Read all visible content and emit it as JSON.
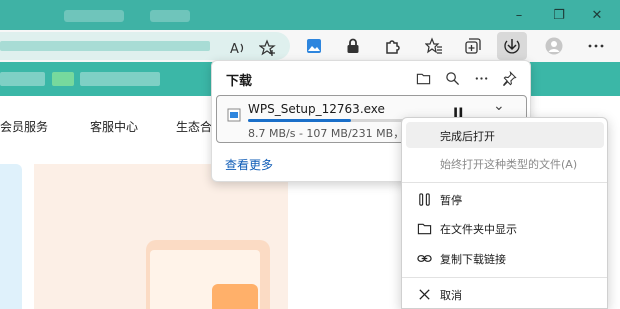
{
  "window": {
    "minimize_icon": "minimize-icon",
    "maximize_icon": "restore-icon",
    "close_icon": "close-icon"
  },
  "toolbar": {
    "read_aloud_icon": "read-aloud-icon",
    "favorite_add_icon": "star-add-icon",
    "extension_icons": [
      "image-icon",
      "lock-icon",
      "puzzle-icon"
    ],
    "favorites_icon": "favorites-icon",
    "collections_icon": "collections-icon",
    "shield_icon": "browser-essentials-icon",
    "downloads_icon": "download-icon",
    "profile_icon": "profile-avatar",
    "more_icon": "more-icon"
  },
  "page": {
    "nav_items": [
      "会员服务",
      "客服中心",
      "生态合"
    ]
  },
  "downloads": {
    "title": "下载",
    "item": {
      "file_name": "WPS_Setup_12763.exe",
      "status": "8.7 MB/s - 107 MB/231 MB，",
      "progress": 0.463,
      "pause_glyph": "II",
      "chevron": "⌄"
    },
    "see_more": "查看更多"
  },
  "context_menu": {
    "items": [
      {
        "label": "完成后打开",
        "highlighted": true,
        "disabled": false
      },
      {
        "label": "始终打开这种类型的文件(A)",
        "highlighted": false,
        "disabled": true
      },
      {
        "label": "暂停",
        "icon": "pause-icon"
      },
      {
        "label": "在文件夹中显示",
        "icon": "folder-icon"
      },
      {
        "label": "复制下载链接",
        "icon": "link-icon"
      },
      {
        "label": "取消",
        "icon": "close-icon"
      }
    ]
  },
  "colors": {
    "titlebar": "#3fb2a5",
    "accent": "#1a6fc9",
    "link": "#0f5cb7"
  }
}
